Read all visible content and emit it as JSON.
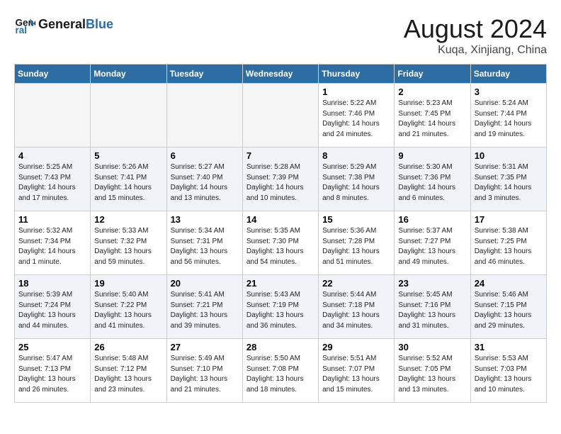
{
  "header": {
    "logo_line1": "General",
    "logo_line2": "Blue",
    "month": "August 2024",
    "location": "Kuqa, Xinjiang, China"
  },
  "weekdays": [
    "Sunday",
    "Monday",
    "Tuesday",
    "Wednesday",
    "Thursday",
    "Friday",
    "Saturday"
  ],
  "weeks": [
    [
      {
        "day": "",
        "info": ""
      },
      {
        "day": "",
        "info": ""
      },
      {
        "day": "",
        "info": ""
      },
      {
        "day": "",
        "info": ""
      },
      {
        "day": "1",
        "info": "Sunrise: 5:22 AM\nSunset: 7:46 PM\nDaylight: 14 hours\nand 24 minutes."
      },
      {
        "day": "2",
        "info": "Sunrise: 5:23 AM\nSunset: 7:45 PM\nDaylight: 14 hours\nand 21 minutes."
      },
      {
        "day": "3",
        "info": "Sunrise: 5:24 AM\nSunset: 7:44 PM\nDaylight: 14 hours\nand 19 minutes."
      }
    ],
    [
      {
        "day": "4",
        "info": "Sunrise: 5:25 AM\nSunset: 7:43 PM\nDaylight: 14 hours\nand 17 minutes."
      },
      {
        "day": "5",
        "info": "Sunrise: 5:26 AM\nSunset: 7:41 PM\nDaylight: 14 hours\nand 15 minutes."
      },
      {
        "day": "6",
        "info": "Sunrise: 5:27 AM\nSunset: 7:40 PM\nDaylight: 14 hours\nand 13 minutes."
      },
      {
        "day": "7",
        "info": "Sunrise: 5:28 AM\nSunset: 7:39 PM\nDaylight: 14 hours\nand 10 minutes."
      },
      {
        "day": "8",
        "info": "Sunrise: 5:29 AM\nSunset: 7:38 PM\nDaylight: 14 hours\nand 8 minutes."
      },
      {
        "day": "9",
        "info": "Sunrise: 5:30 AM\nSunset: 7:36 PM\nDaylight: 14 hours\nand 6 minutes."
      },
      {
        "day": "10",
        "info": "Sunrise: 5:31 AM\nSunset: 7:35 PM\nDaylight: 14 hours\nand 3 minutes."
      }
    ],
    [
      {
        "day": "11",
        "info": "Sunrise: 5:32 AM\nSunset: 7:34 PM\nDaylight: 14 hours\nand 1 minute."
      },
      {
        "day": "12",
        "info": "Sunrise: 5:33 AM\nSunset: 7:32 PM\nDaylight: 13 hours\nand 59 minutes."
      },
      {
        "day": "13",
        "info": "Sunrise: 5:34 AM\nSunset: 7:31 PM\nDaylight: 13 hours\nand 56 minutes."
      },
      {
        "day": "14",
        "info": "Sunrise: 5:35 AM\nSunset: 7:30 PM\nDaylight: 13 hours\nand 54 minutes."
      },
      {
        "day": "15",
        "info": "Sunrise: 5:36 AM\nSunset: 7:28 PM\nDaylight: 13 hours\nand 51 minutes."
      },
      {
        "day": "16",
        "info": "Sunrise: 5:37 AM\nSunset: 7:27 PM\nDaylight: 13 hours\nand 49 minutes."
      },
      {
        "day": "17",
        "info": "Sunrise: 5:38 AM\nSunset: 7:25 PM\nDaylight: 13 hours\nand 46 minutes."
      }
    ],
    [
      {
        "day": "18",
        "info": "Sunrise: 5:39 AM\nSunset: 7:24 PM\nDaylight: 13 hours\nand 44 minutes."
      },
      {
        "day": "19",
        "info": "Sunrise: 5:40 AM\nSunset: 7:22 PM\nDaylight: 13 hours\nand 41 minutes."
      },
      {
        "day": "20",
        "info": "Sunrise: 5:41 AM\nSunset: 7:21 PM\nDaylight: 13 hours\nand 39 minutes."
      },
      {
        "day": "21",
        "info": "Sunrise: 5:43 AM\nSunset: 7:19 PM\nDaylight: 13 hours\nand 36 minutes."
      },
      {
        "day": "22",
        "info": "Sunrise: 5:44 AM\nSunset: 7:18 PM\nDaylight: 13 hours\nand 34 minutes."
      },
      {
        "day": "23",
        "info": "Sunrise: 5:45 AM\nSunset: 7:16 PM\nDaylight: 13 hours\nand 31 minutes."
      },
      {
        "day": "24",
        "info": "Sunrise: 5:46 AM\nSunset: 7:15 PM\nDaylight: 13 hours\nand 29 minutes."
      }
    ],
    [
      {
        "day": "25",
        "info": "Sunrise: 5:47 AM\nSunset: 7:13 PM\nDaylight: 13 hours\nand 26 minutes."
      },
      {
        "day": "26",
        "info": "Sunrise: 5:48 AM\nSunset: 7:12 PM\nDaylight: 13 hours\nand 23 minutes."
      },
      {
        "day": "27",
        "info": "Sunrise: 5:49 AM\nSunset: 7:10 PM\nDaylight: 13 hours\nand 21 minutes."
      },
      {
        "day": "28",
        "info": "Sunrise: 5:50 AM\nSunset: 7:08 PM\nDaylight: 13 hours\nand 18 minutes."
      },
      {
        "day": "29",
        "info": "Sunrise: 5:51 AM\nSunset: 7:07 PM\nDaylight: 13 hours\nand 15 minutes."
      },
      {
        "day": "30",
        "info": "Sunrise: 5:52 AM\nSunset: 7:05 PM\nDaylight: 13 hours\nand 13 minutes."
      },
      {
        "day": "31",
        "info": "Sunrise: 5:53 AM\nSunset: 7:03 PM\nDaylight: 13 hours\nand 10 minutes."
      }
    ]
  ],
  "row_styles": [
    "row-white",
    "row-light",
    "row-white",
    "row-light",
    "row-white"
  ]
}
